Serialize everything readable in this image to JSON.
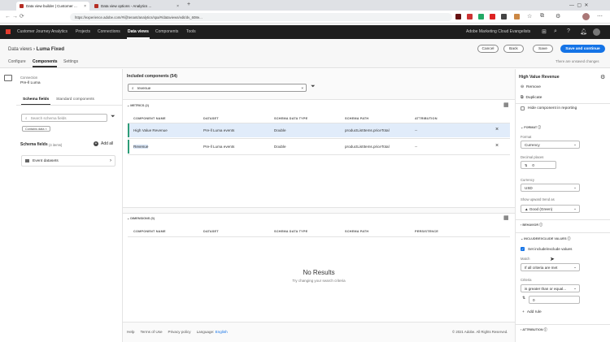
{
  "browser": {
    "tabs": [
      {
        "title": "Data view builder | Customer ...",
        "active": true
      },
      {
        "title": "Data view options - Analytics ...",
        "active": false
      }
    ],
    "new_tab": "+",
    "url": "https://experience.adobe.com/#/@tenant/analytics/spa/#/dataviews/edit/dv_608e..."
  },
  "appbar": {
    "product": "Customer Journey Analytics",
    "nav": [
      "Projects",
      "Connections",
      "Data views",
      "Components",
      "Tools"
    ],
    "active_nav": "Data views",
    "org": "Adobe Marketing Cloud Evangelists"
  },
  "header": {
    "breadcrumb_root": "Data views",
    "breadcrumb_sep": "›",
    "title": "Luma Fixed",
    "tabs": [
      "Configure",
      "Components",
      "Settings"
    ],
    "active_tab": "Components",
    "cancel": "Cancel",
    "back": "Back",
    "save": "Save",
    "save_continue": "Save and continue",
    "unsaved": "There are unsaved changes"
  },
  "left": {
    "connection_label": "Connection",
    "connection_value": "Pre-ll Luma",
    "tabs": [
      "Schema fields",
      "Standard components"
    ],
    "search_placeholder": "Search schema fields",
    "filter_tag": "Contains data",
    "schema_fields_label": "Schema fields",
    "schema_fields_count": "(4 items)",
    "add_all": "Add all",
    "items": [
      "Event datasets"
    ]
  },
  "center": {
    "title": "Included components (54)",
    "search_value": "revenue",
    "metrics": {
      "header": "METRICS (2)",
      "columns": [
        "COMPONENT NAME",
        "DATASET",
        "SCHEMA DATA TYPE",
        "SCHEMA PATH",
        "ATTRIBUTION"
      ],
      "rows": [
        {
          "name": "High Value Revenue",
          "dataset": "Pre-ll Luma events",
          "type": "Double",
          "path": "productListItems.priceTotal",
          "attribution": "--"
        },
        {
          "name": "Revenue",
          "dataset": "Pre-ll Luma events",
          "type": "Double",
          "path": "productListItems.priceTotal",
          "attribution": "--"
        }
      ]
    },
    "dimensions": {
      "header": "DIMENSIONS (0)",
      "columns": [
        "COMPONENT NAME",
        "DATASET",
        "SCHEMA DATA TYPE",
        "SCHEMA PATH",
        "PERSISTENCE"
      ],
      "empty_title": "No Results",
      "empty_sub": "Try changing your search criteria"
    }
  },
  "footer": {
    "links": [
      "Help",
      "Terms of Use",
      "Privacy policy"
    ],
    "language_label": "Language:",
    "language": "English",
    "copyright": "© 2021 Adobe. All Rights Reserved."
  },
  "right": {
    "title": "High Value Revenue",
    "remove": "Remove",
    "duplicate": "Duplicate",
    "hide": "Hide component in reporting",
    "format_section": "FORMAT",
    "format_label": "Format",
    "format_value": "Currency",
    "decimal_label": "Decimal places",
    "decimal_value": "0",
    "currency_label": "Currency",
    "currency_value": "USD",
    "trend_label": "Show upward trend as",
    "trend_value": "▲ Good (Green)",
    "behavior": "BEHAVIOR",
    "include_section": "INCLUDE/EXCLUDE VALUES",
    "set_include": "Set include/exclude values",
    "match_label": "Match",
    "match_value": "If all criteria are met",
    "criteria_label": "Criteria",
    "criteria_value": "is greater than or equal...",
    "criteria_number": "0",
    "add_rule": "Add rule",
    "attribution": "ATTRIBUTION"
  },
  "colors": {
    "accent": "#1473e6",
    "selected_row": "#e1ecfa",
    "green_bar": "#2d9d78",
    "app_bg": "#1e1e1e"
  }
}
